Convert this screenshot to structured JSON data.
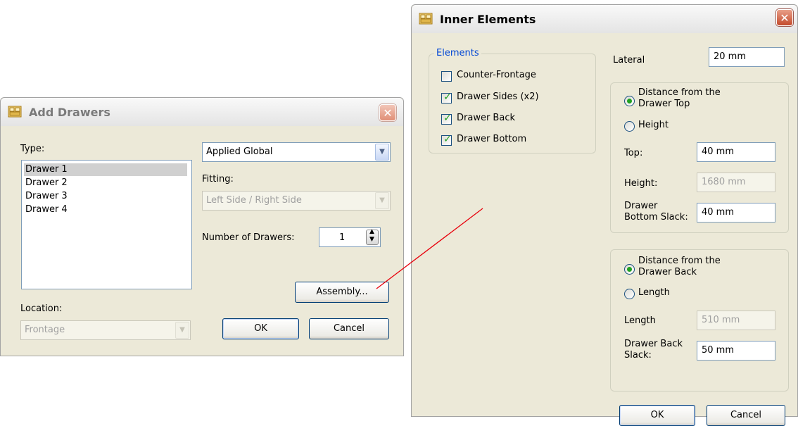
{
  "colors": {
    "dialog_bg": "#ece9d8",
    "link_connector": "#e8000b",
    "group_title": "#0046d5",
    "checkmark": "#21a121"
  },
  "add_drawers": {
    "title": "Add Drawers",
    "type_label": "Type:",
    "types": [
      "Drawer 1",
      "Drawer 2",
      "Drawer 3",
      "Drawer 4"
    ],
    "selected_type": "Drawer 1",
    "applied_value": "Applied Global",
    "fitting_label": "Fitting:",
    "fitting_value": "Left Side / Right Side",
    "number_label": "Number of Drawers:",
    "number_value": "1",
    "assembly_label": "Assembly...",
    "location_label": "Location:",
    "location_value": "Frontage",
    "ok_label": "OK",
    "cancel_label": "Cancel"
  },
  "inner_elements": {
    "title": "Inner Elements",
    "elements_group_label": "Elements",
    "elements": [
      {
        "label": "Counter-Frontage",
        "checked": false
      },
      {
        "label": "Drawer Sides (x2)",
        "checked": true
      },
      {
        "label": "Drawer Back",
        "checked": true
      },
      {
        "label": "Drawer Bottom",
        "checked": true
      }
    ],
    "lateral_label": "Lateral",
    "lateral_value": "20 mm",
    "top_group": {
      "radio_distance_line1": "Distance from the",
      "radio_distance_line2": "Drawer Top",
      "radio_height": "Height",
      "selected": "distance",
      "top_label": "Top:",
      "top_value": "40 mm",
      "height_label": "Height:",
      "height_value": "1680 mm",
      "bottom_slack_line1": "Drawer",
      "bottom_slack_line2": "Bottom Slack:",
      "bottom_slack_value": "40 mm"
    },
    "back_group": {
      "radio_distance_line1": "Distance from the",
      "radio_distance_line2": "Drawer Back",
      "radio_length": "Length",
      "selected": "distance",
      "length_label": "Length",
      "length_value": "510 mm",
      "back_slack_line1": "Drawer Back",
      "back_slack_line2": "Slack:",
      "back_slack_value": "50 mm"
    },
    "ok_label": "OK",
    "cancel_label": "Cancel"
  }
}
